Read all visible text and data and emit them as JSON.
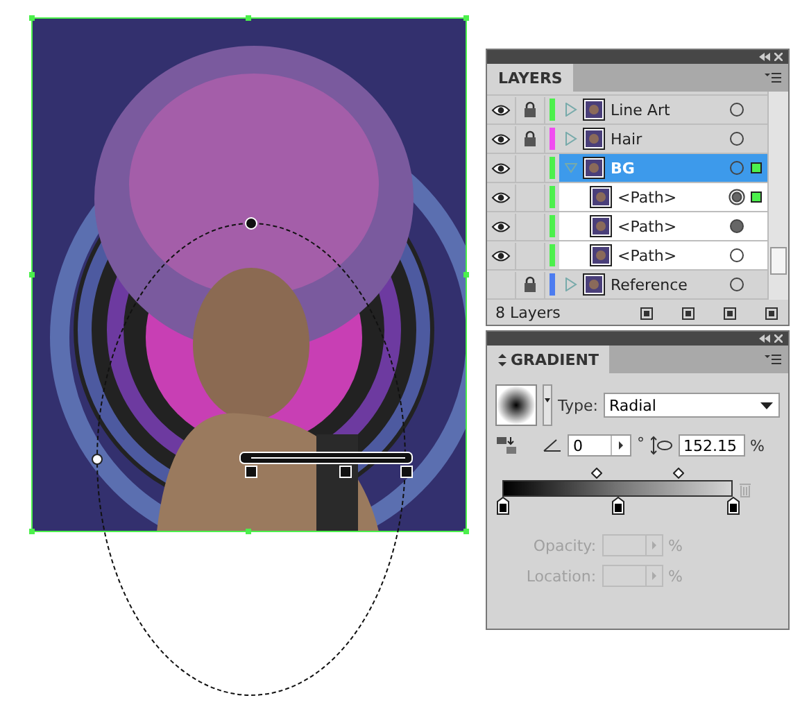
{
  "layers_panel": {
    "title": "LAYERS",
    "layers": [
      {
        "name": "Line Art",
        "visible": true,
        "locked": true,
        "color": "#4cf04c",
        "expanded": false,
        "selected": false,
        "targeted": false,
        "appearance": false,
        "marked": false
      },
      {
        "name": "Hair",
        "visible": true,
        "locked": true,
        "color": "#f04cf0",
        "expanded": false,
        "selected": false,
        "targeted": false,
        "appearance": false,
        "marked": false
      },
      {
        "name": "BG",
        "visible": true,
        "locked": false,
        "color": "#4cf04c",
        "expanded": true,
        "selected": true,
        "targeted": false,
        "appearance": false,
        "marked": true,
        "children": [
          {
            "name": "<Path>",
            "visible": true,
            "locked": false,
            "color": "#4cf04c",
            "selected": false,
            "targeted": true,
            "appearance": true,
            "marked": true
          },
          {
            "name": "<Path>",
            "visible": true,
            "locked": false,
            "color": "#4cf04c",
            "selected": false,
            "targeted": false,
            "appearance": true,
            "marked": false
          },
          {
            "name": "<Path>",
            "visible": true,
            "locked": false,
            "color": "#4cf04c",
            "selected": false,
            "targeted": false,
            "appearance": false,
            "marked": false
          }
        ]
      },
      {
        "name": "Reference",
        "visible": false,
        "locked": true,
        "color": "#4c7cf0",
        "expanded": false,
        "selected": false,
        "targeted": false,
        "appearance": false,
        "marked": false
      }
    ],
    "count": "8 Layers"
  },
  "gradient_panel": {
    "title": "GRADIENT",
    "type_label": "Type:",
    "type": "Radial",
    "angle": "0",
    "angle_unit": "°",
    "aspect": "152.15",
    "aspect_unit": "%",
    "stops": [
      {
        "level": 0
      },
      {
        "level": 0.5
      },
      {
        "level": 1
      }
    ],
    "midpoints": [
      {
        "level": 0.41
      },
      {
        "level": 0.77
      }
    ],
    "opacity": {
      "label": "Opacity:",
      "unit": "%",
      "disabled": true
    },
    "location": {
      "label": "Location:",
      "unit": "%",
      "disabled": true
    }
  }
}
